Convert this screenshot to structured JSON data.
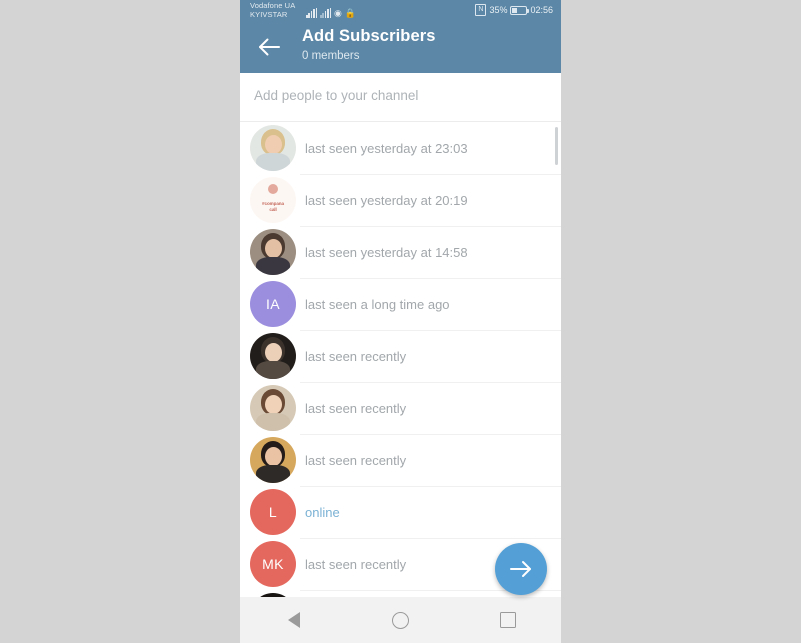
{
  "statusbar": {
    "carrier_line1": "Vodafone UA",
    "carrier_line2": "KYIVSTAR",
    "nfc_icon": "nfc-icon",
    "battery_percent": "35%",
    "time": "02:56",
    "signal_icon_1": "signal-bars-icon",
    "signal_icon_2": "signal-bars-icon",
    "sync_icon": "sync-icon",
    "vpn_icon": "lock-icon"
  },
  "appbar": {
    "back_icon": "back-arrow-icon",
    "title": "Add Subscribers",
    "subtitle": "0 members",
    "color": "#5c87a6"
  },
  "search": {
    "placeholder": "Add people to your channel",
    "value": ""
  },
  "contacts": [
    {
      "avatar_type": "photo",
      "photo": "blonde-woman",
      "initials": "",
      "avatar_color": "#dfe4e6",
      "status": "last seen yesterday at 23:03",
      "online": false
    },
    {
      "avatar_type": "photo",
      "photo": "logo-badge",
      "initials": "",
      "avatar_color": "#fdf6f3",
      "status": "last seen yesterday at 20:19",
      "online": false,
      "badge_line1": "#compana",
      "badge_line2": "call"
    },
    {
      "avatar_type": "photo",
      "photo": "standing-woman",
      "initials": "",
      "avatar_color": "#8c7f73",
      "status": "last seen yesterday at 14:58",
      "online": false
    },
    {
      "avatar_type": "initials",
      "photo": "",
      "initials": "IA",
      "avatar_color": "#9b8ede",
      "status": "last seen a long time ago",
      "online": false
    },
    {
      "avatar_type": "photo",
      "photo": "glasses-woman",
      "initials": "",
      "avatar_color": "#2a2521",
      "status": "last seen recently",
      "online": false
    },
    {
      "avatar_type": "photo",
      "photo": "brown-hair-woman",
      "initials": "",
      "avatar_color": "#cfc3b0",
      "status": "last seen recently",
      "online": false
    },
    {
      "avatar_type": "photo",
      "photo": "sunset-woman",
      "initials": "",
      "avatar_color": "#c8a26a",
      "status": "last seen recently",
      "online": false
    },
    {
      "avatar_type": "initials",
      "photo": "",
      "initials": "L",
      "avatar_color": "#e4685d",
      "status": "online",
      "online": true
    },
    {
      "avatar_type": "initials",
      "photo": "",
      "initials": "MK",
      "avatar_color": "#e4685d",
      "status": "last seen recently",
      "online": false
    },
    {
      "avatar_type": "photo",
      "photo": "dark-hair-woman",
      "initials": "",
      "avatar_color": "#1d1a17",
      "status": "",
      "online": false
    }
  ],
  "fab": {
    "icon": "arrow-right-icon",
    "color": "#54a0d6"
  },
  "navbar": {
    "back_label": "back-nav-button",
    "home_label": "home-nav-button",
    "recents_label": "recents-nav-button"
  }
}
